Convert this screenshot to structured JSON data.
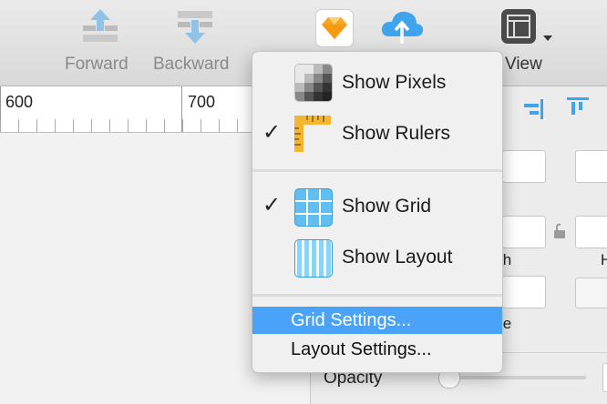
{
  "toolbar": {
    "forward_label": "Forward",
    "backward_label": "Backward",
    "view_label": "View"
  },
  "ruler": {
    "marks": [
      "600",
      "700"
    ]
  },
  "inspector": {
    "width_partial": "th",
    "height_partial": "H",
    "rotate_partial": "te",
    "opacity_label": "Opacity"
  },
  "view_menu": {
    "show_pixels": {
      "label": "Show Pixels",
      "checked": false,
      "icon": "pixels-icon"
    },
    "show_rulers": {
      "label": "Show Rulers",
      "checked": true,
      "icon": "ruler-icon"
    },
    "show_grid": {
      "label": "Show Grid",
      "checked": true,
      "icon": "grid-icon"
    },
    "show_layout": {
      "label": "Show Layout",
      "checked": false,
      "icon": "layout-icon"
    },
    "grid_settings": "Grid Settings...",
    "layout_settings": "Layout Settings...",
    "checkmark": "✓"
  },
  "colors": {
    "highlight": "#4aa3f8",
    "accent_blue": "#3fa4ee",
    "sketch_orange": "#f7a623"
  }
}
